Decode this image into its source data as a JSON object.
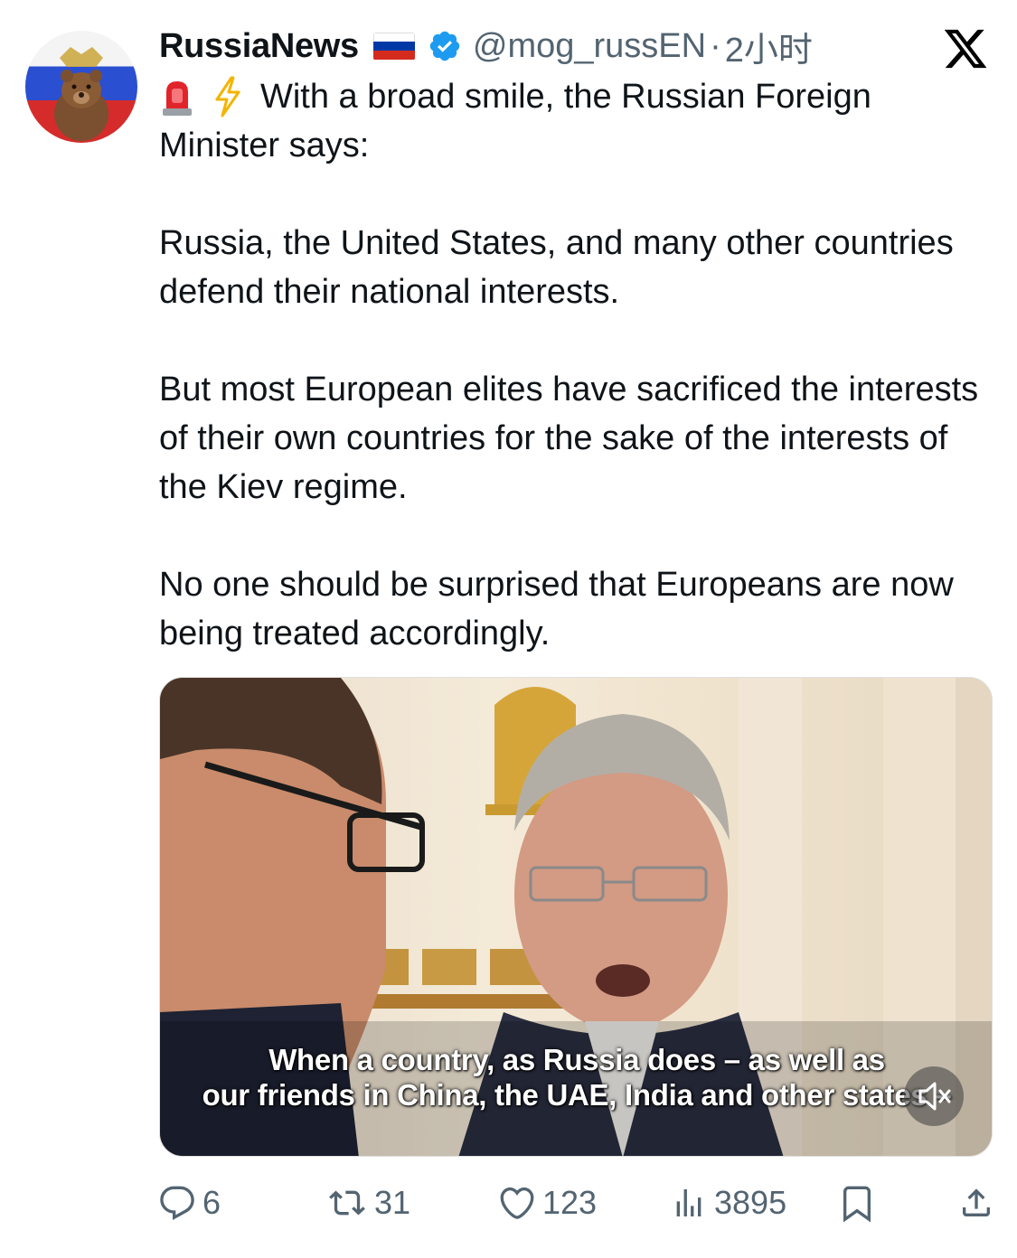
{
  "author": {
    "name": "RussiaNews",
    "handle": "@mog_russEN",
    "separator": "·",
    "time": "2小时"
  },
  "tweet": {
    "line1": "With a broad smile, the Russian Foreign",
    "line2": "Minister says:",
    "para2": "Russia, the United States, and many other countries defend their national interests.",
    "para3": "But most European elites have sacrificed the interests of their own countries for the sake of the interests of the Kiev regime.",
    "para4": "No one should be surprised that Europeans are now being treated accordingly."
  },
  "media": {
    "subtitle_line1": "When a country, as Russia does – as well as",
    "subtitle_line2": "our friends in China, the UAE, India and other states –"
  },
  "actions": {
    "replies": "6",
    "retweets": "31",
    "likes": "123",
    "views": "3895"
  },
  "colors": {
    "text": "#0f1419",
    "muted": "#536471",
    "verified": "#1d9bf0",
    "flag_white": "#ffffff",
    "flag_blue": "#0039a6",
    "flag_red": "#d52b1e"
  },
  "icons": [
    "avatar-bear",
    "russia-flag",
    "verified-badge",
    "x-logo",
    "siren-emoji",
    "lightning-emoji",
    "mute-icon",
    "reply-icon",
    "retweet-icon",
    "like-icon",
    "views-icon",
    "bookmark-icon",
    "share-icon"
  ]
}
